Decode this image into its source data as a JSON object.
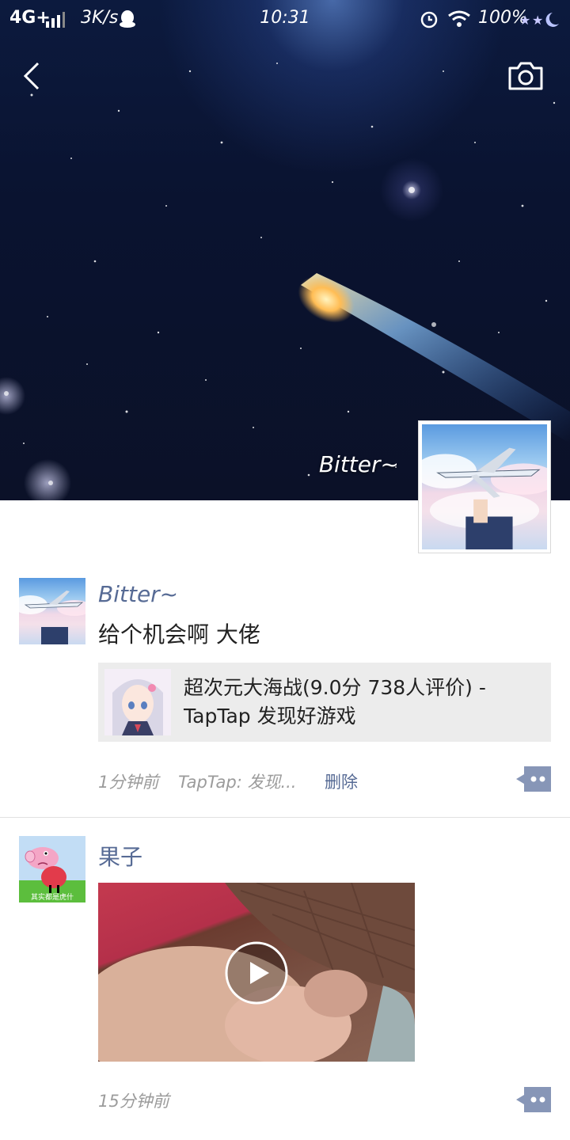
{
  "status_bar": {
    "network": "4G+",
    "speed": "3K/s",
    "time": "10:31",
    "battery": "100%",
    "icons": [
      "signal-icon",
      "qq-penguin-icon",
      "alarm-icon",
      "wifi-icon",
      "weather-stars-icon"
    ]
  },
  "header": {
    "back_icon": "chevron-left-icon",
    "camera_icon": "camera-icon",
    "cover_name": "Bitter~"
  },
  "posts": [
    {
      "name": "Bitter~",
      "text": "给个机会啊 大佬",
      "link": {
        "title": "超次元大海战(9.0分 738人评价) - TapTap 发现好游戏"
      },
      "time": "1分钟前",
      "source": "TapTap: 发现...",
      "delete_label": "删除"
    },
    {
      "name": "果子",
      "avatar_caption": "其实都是虎什",
      "time": "15分钟前",
      "has_video": true
    }
  ],
  "colors": {
    "name_link": "#576b95",
    "meta": "#9b9b9b",
    "card_bg": "#ececec"
  }
}
